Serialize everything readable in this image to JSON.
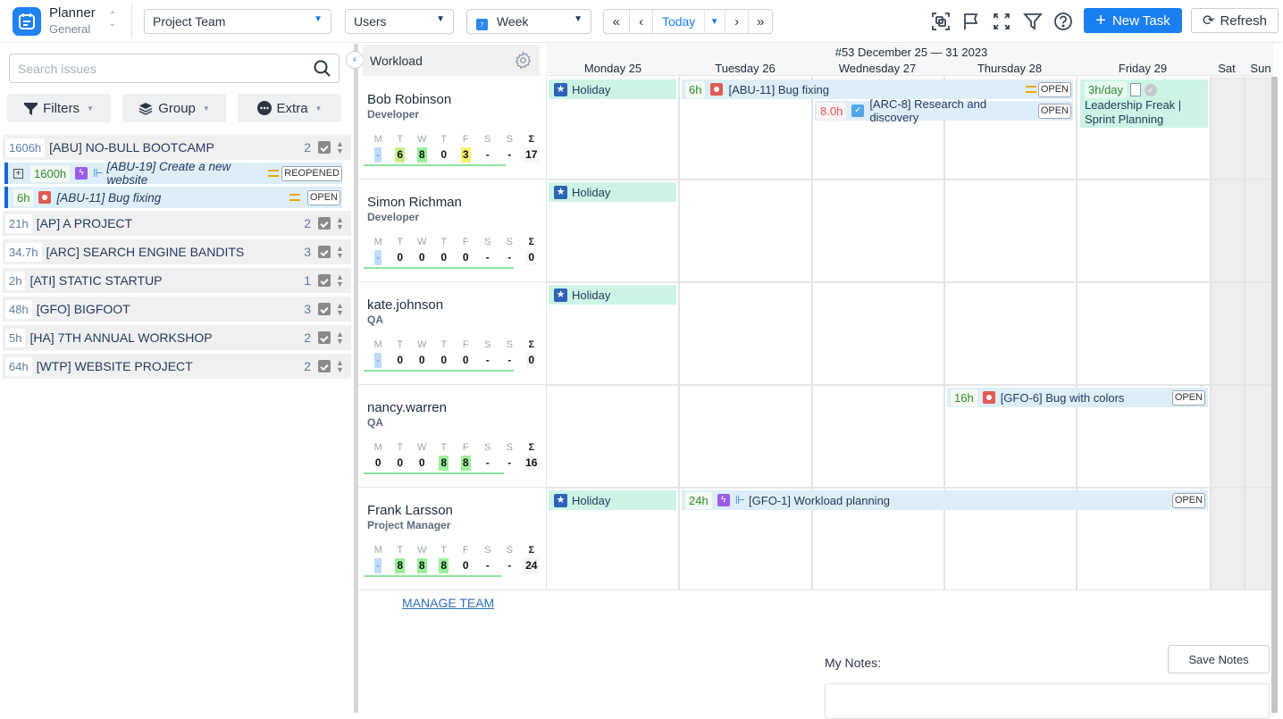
{
  "app": {
    "title": "Planner",
    "subtitle": "General"
  },
  "toolbar": {
    "team_select": "Project Team",
    "users_select": "Users",
    "view_select": "Week",
    "view_icon_day": "7",
    "nav": {
      "first": "«",
      "prev": "‹",
      "today": "Today",
      "today_menu": "⌄",
      "next": "›",
      "last": "»"
    },
    "icons": [
      "focus-icon",
      "flag-icon",
      "fullscreen-icon",
      "filter-icon",
      "help-icon"
    ],
    "new_task": "New Task",
    "refresh": "Refresh"
  },
  "sidebar": {
    "search_placeholder": "Search issues",
    "filters": "Filters",
    "group": "Group",
    "extra": "Extra",
    "projects": [
      {
        "hours": "1606h",
        "name": "[ABU] NO-BULL BOOTCAMP",
        "count": "2"
      },
      {
        "hours": "21h",
        "name": "[AP] A PROJECT",
        "count": "2"
      },
      {
        "hours": "34.7h",
        "name": "[ARC] SEARCH ENGINE BANDITS",
        "count": "3"
      },
      {
        "hours": "2h",
        "name": "[ATI] STATIC STARTUP",
        "count": "1"
      },
      {
        "hours": "48h",
        "name": "[GFO] BIGFOOT",
        "count": "3"
      },
      {
        "hours": "5h",
        "name": "[HA] 7TH ANNUAL WORKSHOP",
        "count": "2"
      },
      {
        "hours": "64h",
        "name": "[WTP] WEBSITE PROJECT",
        "count": "2"
      }
    ],
    "issues": [
      {
        "expand": "+",
        "hours": "1600h",
        "title": "[ABU-19] Create a new website",
        "status": "REOPENED"
      },
      {
        "hours": "6h",
        "title": "[ABU-11] Bug fixing",
        "status": "OPEN"
      }
    ]
  },
  "workload": {
    "title": "Workload",
    "collapse_icon": "‹",
    "week_title": "#53 December 25 — 31 2023",
    "days": [
      "Monday 25",
      "Tuesday 26",
      "Wednesday 27",
      "Thursday 28",
      "Friday 29",
      "Sat",
      "Sun"
    ],
    "day_letters": [
      "M",
      "T",
      "W",
      "T",
      "F",
      "S",
      "S",
      "Σ"
    ],
    "users": [
      {
        "name": "Bob Robinson",
        "role": "Developer",
        "values": [
          "-",
          "6",
          "8",
          "0",
          "3",
          "-",
          "-"
        ],
        "total": "17"
      },
      {
        "name": "Simon Richman",
        "role": "Developer",
        "values": [
          "-",
          "0",
          "0",
          "0",
          "0",
          "-",
          "-"
        ],
        "total": "0"
      },
      {
        "name": "kate.johnson",
        "role": "QA",
        "values": [
          "-",
          "0",
          "0",
          "0",
          "0",
          "-",
          "-"
        ],
        "total": "0"
      },
      {
        "name": "nancy.warren",
        "role": "QA",
        "values": [
          "0",
          "0",
          "0",
          "8",
          "8",
          "-",
          "-"
        ],
        "total": "16"
      },
      {
        "name": "Frank Larsson",
        "role": "Project Manager",
        "values": [
          "-",
          "8",
          "8",
          "8",
          "0",
          "-",
          "-"
        ],
        "total": "24"
      }
    ],
    "events": {
      "holiday": "Holiday",
      "bob_bug": {
        "hours": "6h",
        "title": "[ABU-11] Bug fixing",
        "status": "OPEN"
      },
      "bob_research": {
        "hours": "8.0h",
        "title": "[ARC-8] Research and discovery",
        "status": "OPEN"
      },
      "bob_meeting": {
        "hours": "3h/day",
        "line1": "Leadership Freak |",
        "line2": "Sprint Planning"
      },
      "nancy_bug": {
        "hours": "16h",
        "title": "[GFO-6] Bug with colors",
        "status": "OPEN"
      },
      "frank_task": {
        "hours": "24h",
        "title": "[GFO-1] Workload planning",
        "status": "OPEN"
      }
    },
    "manage_team": "MANAGE TEAM"
  },
  "notes": {
    "label": "My Notes:",
    "save": "Save Notes",
    "value": ""
  },
  "colors": {
    "accent": "#1a7ff0",
    "holiday": "#cdf5e6",
    "task": "#deeef8",
    "bug": "#e05c50",
    "epic": "#9b5de5"
  }
}
